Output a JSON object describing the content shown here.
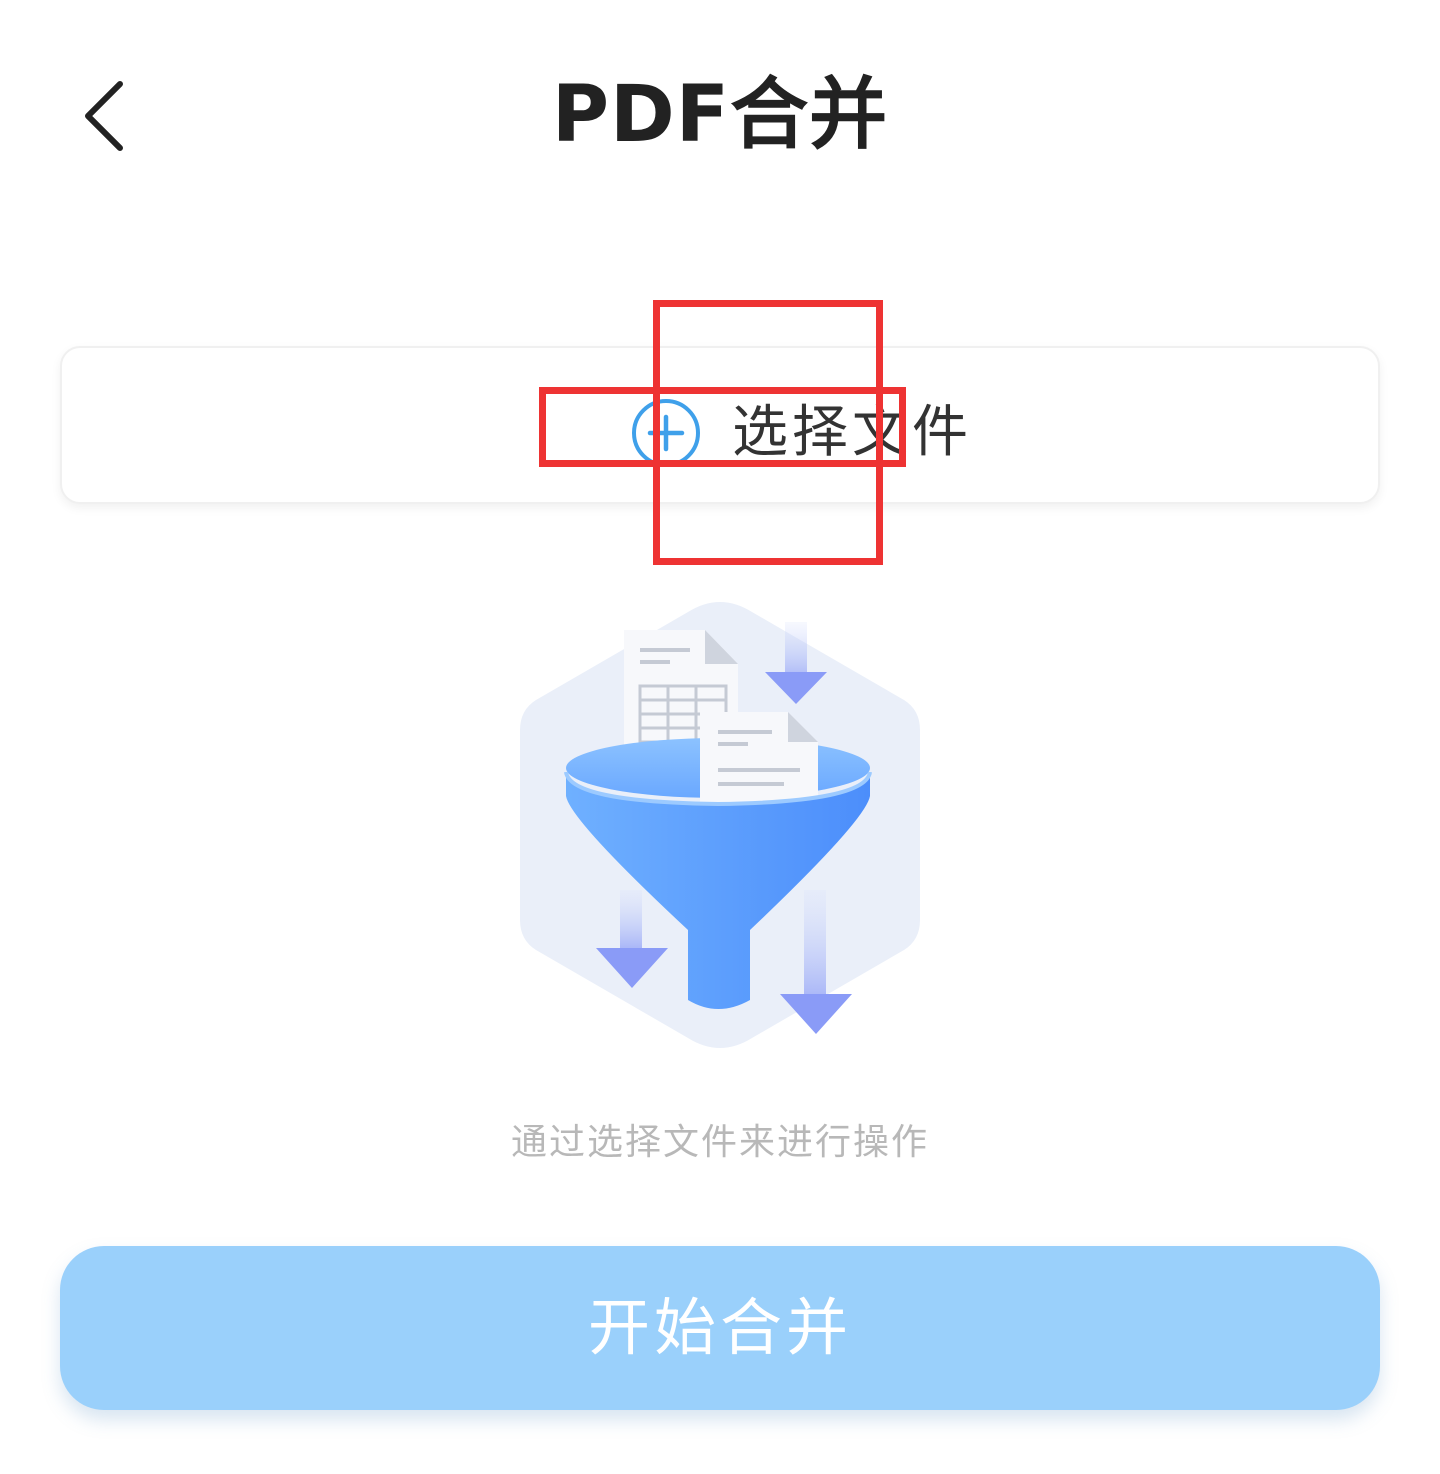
{
  "header": {
    "title": "PDF合并",
    "back_icon": "chevron-left-icon"
  },
  "select_card": {
    "label": "选择文件",
    "icon": "plus-circle-icon",
    "accent_color": "#3fa0ea"
  },
  "illustration": {
    "icon": "funnel-merge-illustration"
  },
  "hint": "通过选择文件来进行操作",
  "start_button": {
    "label": "开始合并",
    "color": "#9ad0fb",
    "enabled": false
  },
  "annotation_color": "#ee3333"
}
